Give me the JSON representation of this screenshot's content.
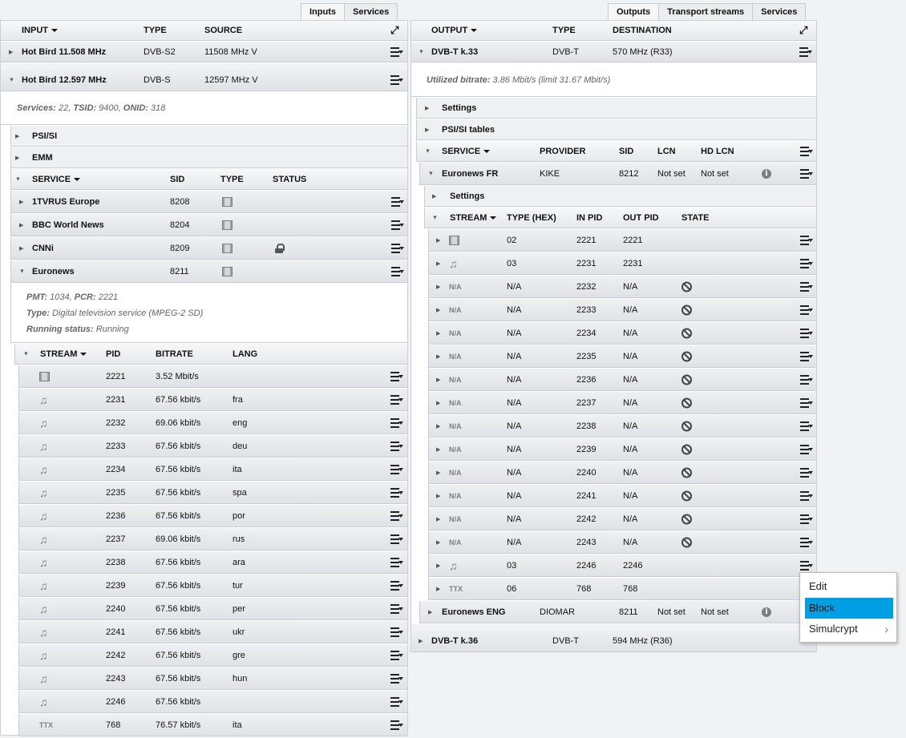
{
  "inputs_panel": {
    "tabs": [
      "Inputs",
      "Services"
    ],
    "header": {
      "input": "INPUT",
      "type": "TYPE",
      "source": "SOURCE"
    },
    "inputs": [
      {
        "name": "Hot Bird 11.508 MHz",
        "type": "DVB-S2",
        "source": "11508 MHz V"
      },
      {
        "name": "Hot Bird 12.597 MHz",
        "type": "DVB-S",
        "source": "12597 MHz V"
      }
    ],
    "summary": {
      "services_label": "Services:",
      "services": "22",
      "tsid_label": "TSID:",
      "tsid": "9400",
      "onid_label": "ONID:",
      "onid": "318"
    },
    "psi_si": "PSI/SI",
    "emm": "EMM",
    "service_header": {
      "service": "SERVICE",
      "sid": "SID",
      "type": "TYPE",
      "status": "STATUS"
    },
    "services": [
      {
        "name": "1TVRUS Europe",
        "sid": "8208"
      },
      {
        "name": "BBC World News",
        "sid": "8204"
      },
      {
        "name": "CNNi",
        "sid": "8209"
      },
      {
        "name": "Euronews",
        "sid": "8211"
      }
    ],
    "details": {
      "pmt_label": "PMT:",
      "pmt": "1034",
      "pcr_label": "PCR:",
      "pcr": "2221",
      "type_label": "Type:",
      "type": "Digital television service (MPEG-2 SD)",
      "running_label": "Running status:",
      "running": "Running"
    },
    "stream_header": {
      "stream": "STREAM",
      "pid": "PID",
      "bitrate": "BITRATE",
      "lang": "LANG"
    },
    "streams": [
      {
        "icon": "video",
        "pid": "2221",
        "bitrate": "3.52 Mbit/s",
        "lang": ""
      },
      {
        "icon": "audio",
        "pid": "2231",
        "bitrate": "67.56 kbit/s",
        "lang": "fra"
      },
      {
        "icon": "audio",
        "pid": "2232",
        "bitrate": "69.06 kbit/s",
        "lang": "eng"
      },
      {
        "icon": "audio",
        "pid": "2233",
        "bitrate": "67.56 kbit/s",
        "lang": "deu"
      },
      {
        "icon": "audio",
        "pid": "2234",
        "bitrate": "67.56 kbit/s",
        "lang": "ita"
      },
      {
        "icon": "audio",
        "pid": "2235",
        "bitrate": "67.56 kbit/s",
        "lang": "spa"
      },
      {
        "icon": "audio",
        "pid": "2236",
        "bitrate": "67.56 kbit/s",
        "lang": "por"
      },
      {
        "icon": "audio",
        "pid": "2237",
        "bitrate": "69.06 kbit/s",
        "lang": "rus"
      },
      {
        "icon": "audio",
        "pid": "2238",
        "bitrate": "67.56 kbit/s",
        "lang": "ara"
      },
      {
        "icon": "audio",
        "pid": "2239",
        "bitrate": "67.56 kbit/s",
        "lang": "tur"
      },
      {
        "icon": "audio",
        "pid": "2240",
        "bitrate": "67.56 kbit/s",
        "lang": "per"
      },
      {
        "icon": "audio",
        "pid": "2241",
        "bitrate": "67.56 kbit/s",
        "lang": "ukr"
      },
      {
        "icon": "audio",
        "pid": "2242",
        "bitrate": "67.56 kbit/s",
        "lang": "gre"
      },
      {
        "icon": "audio",
        "pid": "2243",
        "bitrate": "67.56 kbit/s",
        "lang": "hun"
      },
      {
        "icon": "audio",
        "pid": "2246",
        "bitrate": "67.56 kbit/s",
        "lang": ""
      },
      {
        "icon": "TTX",
        "pid": "768",
        "bitrate": "76.57 kbit/s",
        "lang": "ita"
      }
    ]
  },
  "outputs_panel": {
    "tabs": [
      "Outputs",
      "Transport streams",
      "Services"
    ],
    "header": {
      "output": "OUTPUT",
      "type": "TYPE",
      "destination": "DESTINATION"
    },
    "outputs": [
      {
        "name": "DVB-T k.33",
        "type": "DVB-T",
        "destination": "570 MHz (R33)"
      },
      {
        "name": "DVB-T k.36",
        "type": "DVB-T",
        "destination": "594 MHz (R36)"
      }
    ],
    "bitrate_label": "Utilized bitrate:",
    "bitrate": "3.86 Mbit/s (limit 31.67 Mbit/s)",
    "settings": "Settings",
    "psi_si_tables": "PSI/SI tables",
    "service_header": {
      "service": "SERVICE",
      "provider": "PROVIDER",
      "sid": "SID",
      "lcn": "LCN",
      "hd_lcn": "HD LCN"
    },
    "services": [
      {
        "name": "Euronews FR",
        "provider": "KIKE",
        "sid": "8212",
        "lcn": "Not set",
        "hd_lcn": "Not set"
      },
      {
        "name": "Euronews ENG",
        "provider": "DIOMAR",
        "sid": "8211",
        "lcn": "Not set",
        "hd_lcn": "Not set"
      }
    ],
    "service_settings": "Settings",
    "stream_header": {
      "stream": "STREAM",
      "type_hex": "TYPE (HEX)",
      "in_pid": "IN PID",
      "out_pid": "OUT PID",
      "state": "STATE"
    },
    "streams": [
      {
        "icon": "video",
        "type_hex": "02",
        "in_pid": "2221",
        "out_pid": "2221",
        "blocked": false
      },
      {
        "icon": "audio",
        "type_hex": "03",
        "in_pid": "2231",
        "out_pid": "2231",
        "blocked": false
      },
      {
        "icon": "N/A",
        "type_hex": "N/A",
        "in_pid": "2232",
        "out_pid": "N/A",
        "blocked": true
      },
      {
        "icon": "N/A",
        "type_hex": "N/A",
        "in_pid": "2233",
        "out_pid": "N/A",
        "blocked": true
      },
      {
        "icon": "N/A",
        "type_hex": "N/A",
        "in_pid": "2234",
        "out_pid": "N/A",
        "blocked": true
      },
      {
        "icon": "N/A",
        "type_hex": "N/A",
        "in_pid": "2235",
        "out_pid": "N/A",
        "blocked": true
      },
      {
        "icon": "N/A",
        "type_hex": "N/A",
        "in_pid": "2236",
        "out_pid": "N/A",
        "blocked": true
      },
      {
        "icon": "N/A",
        "type_hex": "N/A",
        "in_pid": "2237",
        "out_pid": "N/A",
        "blocked": true
      },
      {
        "icon": "N/A",
        "type_hex": "N/A",
        "in_pid": "2238",
        "out_pid": "N/A",
        "blocked": true
      },
      {
        "icon": "N/A",
        "type_hex": "N/A",
        "in_pid": "2239",
        "out_pid": "N/A",
        "blocked": true
      },
      {
        "icon": "N/A",
        "type_hex": "N/A",
        "in_pid": "2240",
        "out_pid": "N/A",
        "blocked": true
      },
      {
        "icon": "N/A",
        "type_hex": "N/A",
        "in_pid": "2241",
        "out_pid": "N/A",
        "blocked": true
      },
      {
        "icon": "N/A",
        "type_hex": "N/A",
        "in_pid": "2242",
        "out_pid": "N/A",
        "blocked": true
      },
      {
        "icon": "N/A",
        "type_hex": "N/A",
        "in_pid": "2243",
        "out_pid": "N/A",
        "blocked": true
      },
      {
        "icon": "audio",
        "type_hex": "03",
        "in_pid": "2246",
        "out_pid": "2246",
        "blocked": false
      },
      {
        "icon": "TTX",
        "type_hex": "06",
        "in_pid": "768",
        "out_pid": "768",
        "blocked": false
      }
    ]
  },
  "context_menu": {
    "items": [
      {
        "label": "Edit",
        "selected": false
      },
      {
        "label": "Block",
        "selected": true
      },
      {
        "label": "Simulcrypt",
        "selected": false,
        "submenu": true
      }
    ]
  },
  "colors": {
    "highlight": "#009ee3",
    "row": "#e4e7ea",
    "header": "#eceef0"
  }
}
